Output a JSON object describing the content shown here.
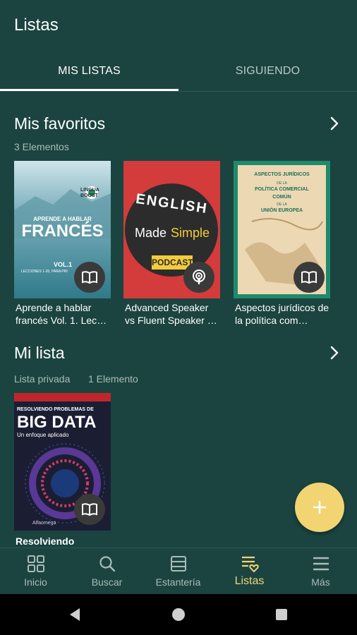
{
  "header": {
    "title": "Listas"
  },
  "tabs": [
    {
      "label": "MIS LISTAS",
      "active": true
    },
    {
      "label": "SIGUIENDO",
      "active": false
    }
  ],
  "sections": [
    {
      "title": "Mis favoritos",
      "subtitle": "3 Elementos",
      "books": [
        {
          "title": "Aprende a hablar francés Vol. 1. Lec…",
          "type": "book-icon",
          "cover": {
            "small": "APRENDE A HABLAR",
            "big": "FRANCÉS",
            "vol": "VOL.1",
            "lecciones": "LECCIONES 1-20, PARA PRI",
            "logo": "LINGUA BOOST"
          }
        },
        {
          "title": "Advanced Speaker vs Fluent Speaker …",
          "type": "podcast-icon",
          "cover": {
            "line1": "ENGLISH",
            "line2a": "Made",
            "line2b": "Simple",
            "line3": "PODCAST"
          }
        },
        {
          "title": "Aspectos jurídicos de la política com…",
          "type": "book-icon",
          "cover": {
            "l1": "ASPECTOS JURÍDICOS",
            "l2": "DE LA",
            "l3": "POLÍTICA COMERCIAL",
            "l4": "COMÚN",
            "l5": "DE LA",
            "l6": "UNIÓN EUROPEA"
          }
        }
      ]
    },
    {
      "title": "Mi lista",
      "subtitle_privacy": "Lista privada",
      "subtitle_count": "1 Elemento",
      "books": [
        {
          "title": "Resolviendo",
          "type": "book-icon",
          "cover": {
            "top": "RESOLVIENDO PROBLEMAS DE",
            "big": "BIG DATA",
            "sub": "Un enfoque aplicado",
            "publisher": "Alfaomega"
          }
        }
      ]
    }
  ],
  "fab": {
    "label": "+"
  },
  "bottom_nav": [
    {
      "label": "Inicio",
      "icon": "grid-icon",
      "active": false
    },
    {
      "label": "Buscar",
      "icon": "search-icon",
      "active": false
    },
    {
      "label": "Estantería",
      "icon": "shelf-icon",
      "active": false
    },
    {
      "label": "Listas",
      "icon": "list-heart-icon",
      "active": true
    },
    {
      "label": "Más",
      "icon": "menu-icon",
      "active": false
    }
  ],
  "colors": {
    "background": "#1b4440",
    "accent": "#f2d472",
    "muted": "#a9bcb8"
  }
}
